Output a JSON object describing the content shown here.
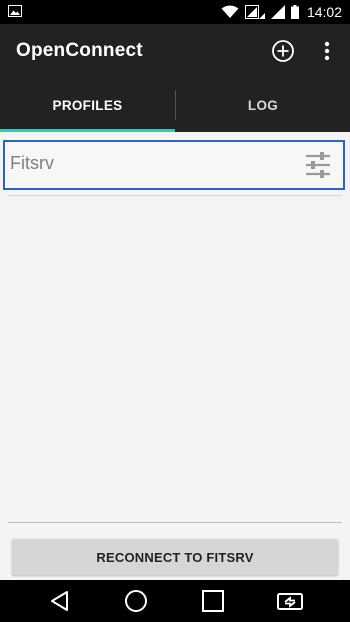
{
  "status_bar": {
    "time": "14:02",
    "icons": [
      "image-notification-icon",
      "wifi-icon",
      "cellular-signal-icon",
      "battery-icon"
    ]
  },
  "app_bar": {
    "title": "OpenConnect",
    "actions": [
      "add-circle-icon",
      "overflow-menu-icon"
    ]
  },
  "tabs": [
    {
      "label": "PROFILES",
      "selected": true
    },
    {
      "label": "LOG",
      "selected": false
    }
  ],
  "profiles": [
    {
      "name": "Fitsrv",
      "action_icon": "settings-sliders-icon"
    }
  ],
  "reconnect_button": {
    "label": "RECONNECT TO FITSRV"
  },
  "nav_bar": {
    "buttons": [
      "back-icon",
      "home-icon",
      "recents-icon",
      "switch-app-icon"
    ]
  },
  "colors": {
    "app_bar": "#222222",
    "tab_indicator": "#3cc5b1",
    "selection_border": "#2a64c8",
    "background": "#f4f4f4"
  }
}
